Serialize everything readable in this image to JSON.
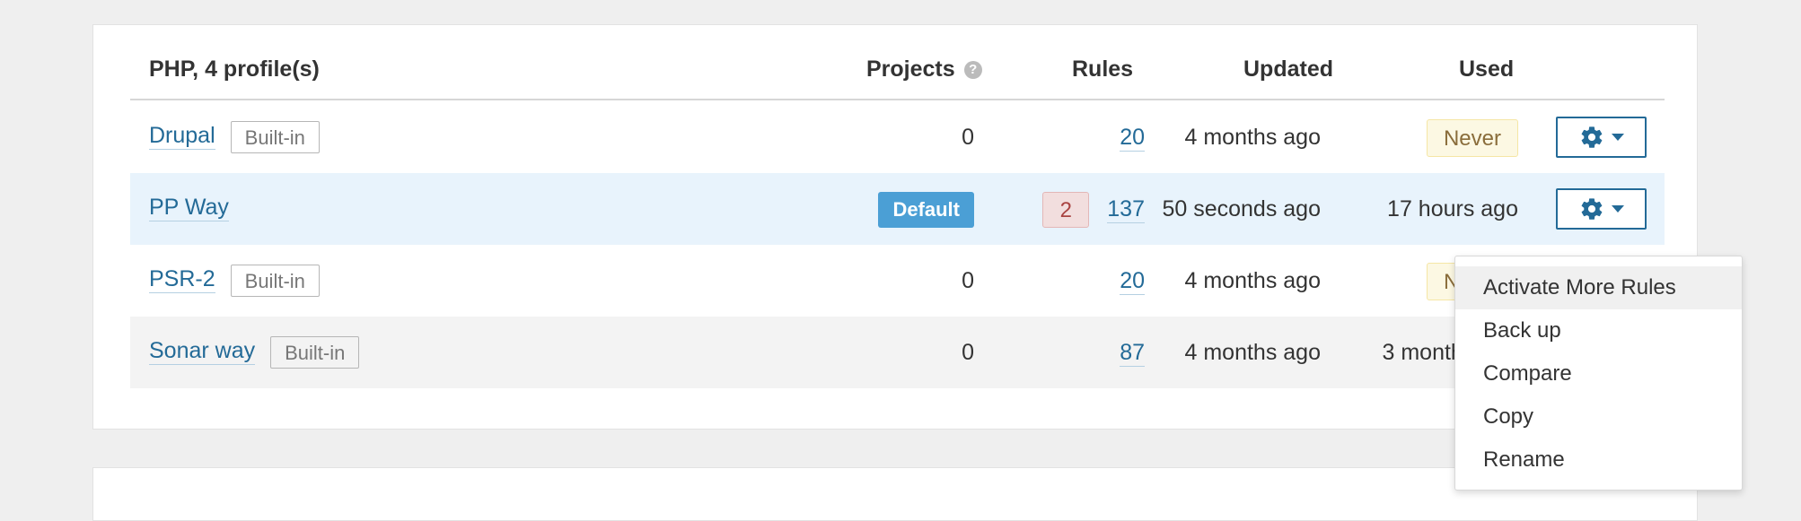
{
  "header": {
    "language_title": "PHP, 4 profile(s)",
    "projects": "Projects",
    "help_icon": "?",
    "rules": "Rules",
    "updated": "Updated",
    "used": "Used"
  },
  "profiles": [
    {
      "name": "Drupal",
      "badge": "Built-in",
      "projects": "0",
      "deprecated": "",
      "rules": "20",
      "updated": "4 months ago",
      "used": "Never"
    },
    {
      "name": "PP Way",
      "badge": "",
      "default_badge": "Default",
      "projects": "",
      "deprecated": "2",
      "rules": "137",
      "updated": "50 seconds ago",
      "used": "17 hours ago"
    },
    {
      "name": "PSR-2",
      "badge": "Built-in",
      "projects": "0",
      "deprecated": "",
      "rules": "20",
      "updated": "4 months ago",
      "used": "Never"
    },
    {
      "name": "Sonar way",
      "badge": "Built-in",
      "projects": "0",
      "deprecated": "",
      "rules": "87",
      "updated": "4 months ago",
      "used": "3 months ago"
    }
  ],
  "actions_menu": {
    "items": [
      "Activate More Rules",
      "Back up",
      "Compare",
      "Copy",
      "Rename"
    ]
  },
  "colors": {
    "link": "#236a97",
    "default_badge": "#4b9fd5",
    "selected_row": "#e8f3fc",
    "never_badge_bg": "#fcf8e3",
    "deprecated_bg": "#f2dede"
  },
  "icons": {
    "actions": "gear-icon",
    "dropdown": "caret-down-icon",
    "help": "help-icon"
  }
}
